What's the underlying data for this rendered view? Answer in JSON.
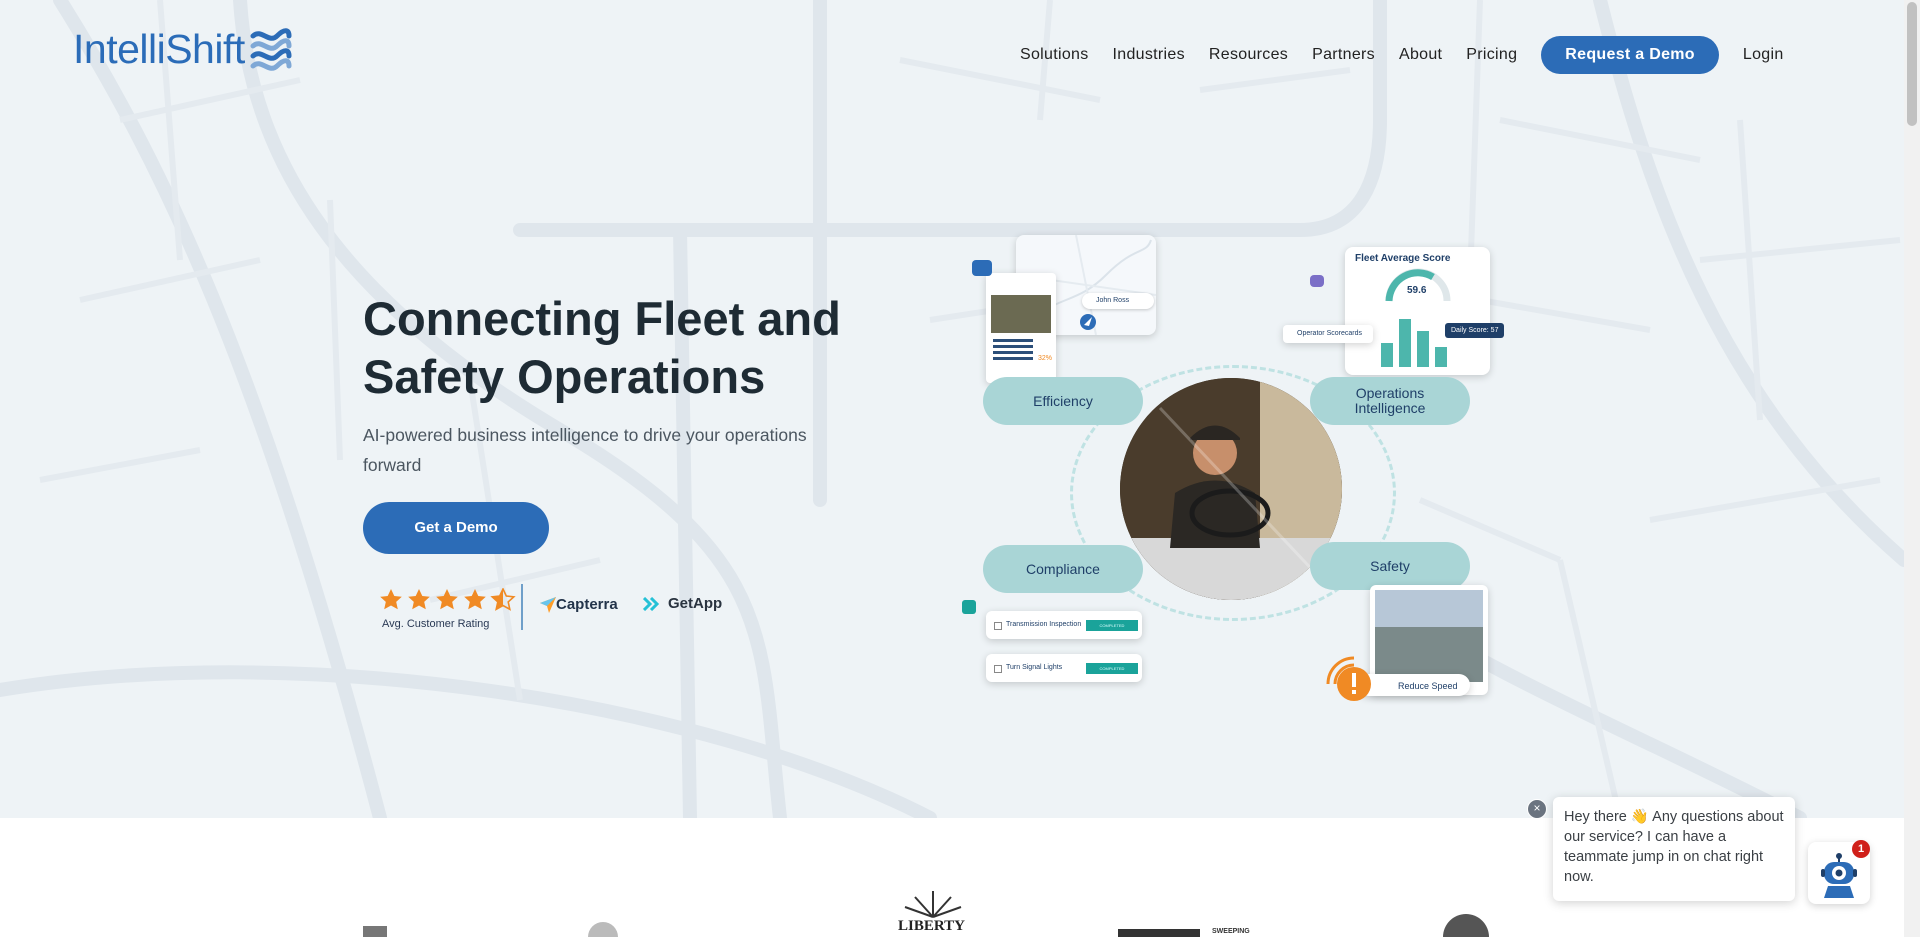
{
  "brand": {
    "name": "IntelliShift",
    "accent": "#2c6cb7"
  },
  "nav": {
    "items": [
      "Solutions",
      "Industries",
      "Resources",
      "Partners",
      "About",
      "Pricing"
    ],
    "demo_label": "Request a Demo",
    "login_label": "Login"
  },
  "hero": {
    "headline": "Connecting Fleet and Safety Operations",
    "subhead": "AI-powered business intelligence to drive your operations forward",
    "cta_label": "Get a Demo",
    "rating": {
      "stars": 4.5,
      "max_stars": 5,
      "label": "Avg. Customer Rating"
    },
    "review_sites": [
      "Capterra",
      "GetApp"
    ]
  },
  "graphic": {
    "pills": {
      "efficiency": "Efficiency",
      "operations": "Operations Intelligence",
      "compliance": "Compliance",
      "safety": "Safety"
    },
    "fleet_score": {
      "title": "Fleet Average Score",
      "value": "59.6",
      "daily": "Daily Score: 57",
      "dropdown": "Operator Scorecards"
    },
    "map_card": {
      "name": "John Ross",
      "percent": "32%"
    },
    "checklist": [
      {
        "label": "Transmission Inspection",
        "status": "COMPLETED"
      },
      {
        "label": "Turn Signal Lights",
        "status": "COMPLETED"
      }
    ],
    "alert": {
      "label": "Reduce Speed"
    }
  },
  "partner_logos": [
    "LIBERTY",
    "SWEEPING"
  ],
  "chat": {
    "message": "Hey there 👋 Any questions about our service? I can have a teammate jump in on chat right now.",
    "badge_count": "1",
    "close_glyph": "×"
  }
}
